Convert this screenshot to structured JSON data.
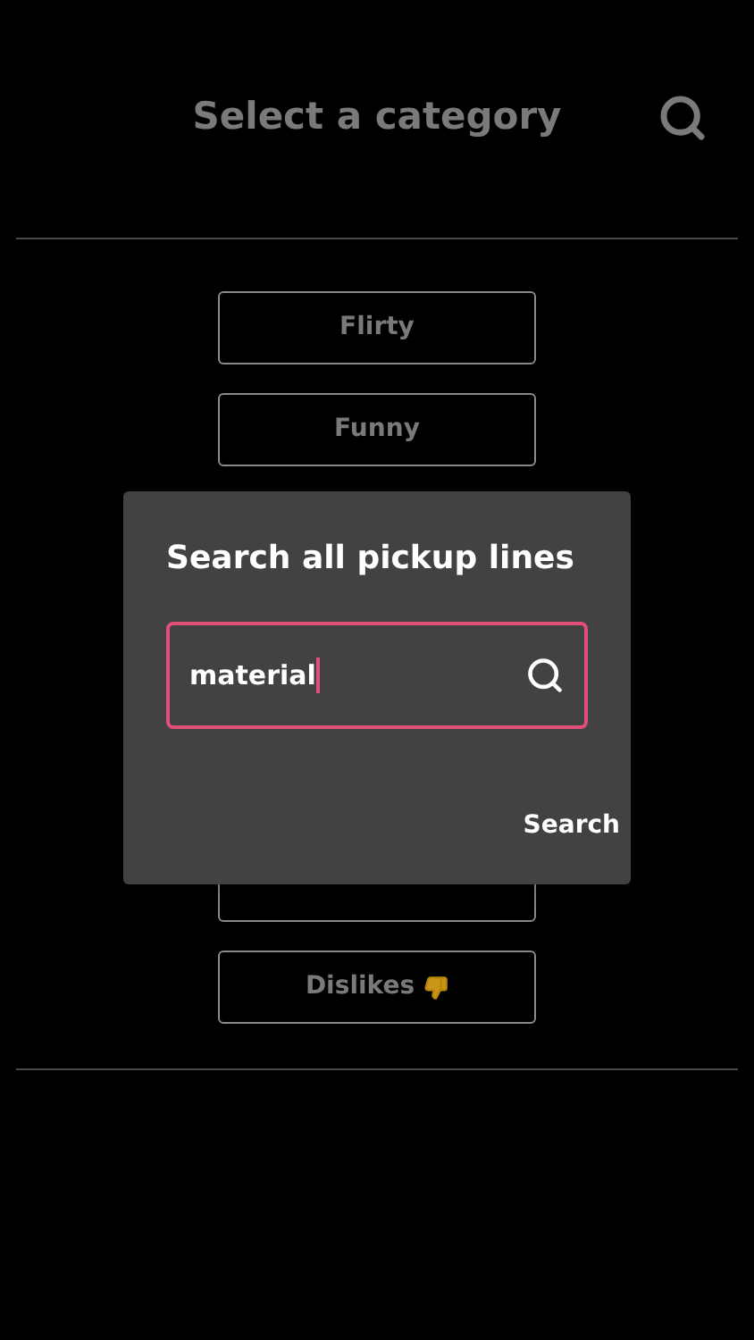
{
  "header": {
    "title": "Select a category"
  },
  "categories": [
    {
      "label": "Flirty",
      "kind": "plain"
    },
    {
      "label": "Funny",
      "kind": "plain"
    },
    {
      "kind": "covered"
    },
    {
      "label": "Dislikes",
      "kind": "thumbs-down"
    }
  ],
  "dialog": {
    "title": "Search all pickup lines",
    "field": {
      "value": "material"
    },
    "action": "Search"
  }
}
